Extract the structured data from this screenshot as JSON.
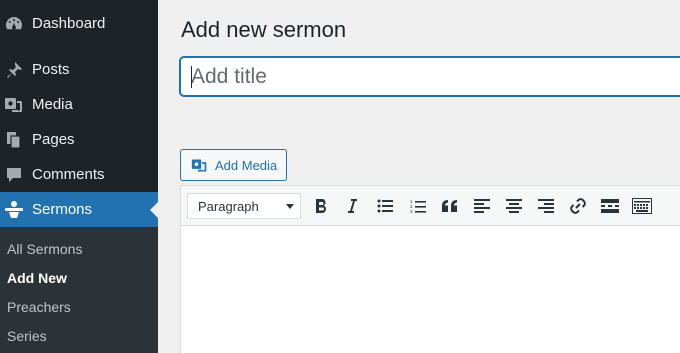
{
  "sidebar": {
    "items": [
      {
        "label": "Dashboard",
        "icon": "dashboard-icon"
      },
      {
        "label": "Posts",
        "icon": "pushpin-icon"
      },
      {
        "label": "Media",
        "icon": "media-icon"
      },
      {
        "label": "Pages",
        "icon": "pages-icon"
      },
      {
        "label": "Comments",
        "icon": "comment-icon"
      },
      {
        "label": "Sermons",
        "icon": "sermon-icon",
        "active": true
      }
    ],
    "submenu": [
      {
        "label": "All Sermons"
      },
      {
        "label": "Add New",
        "current": true
      },
      {
        "label": "Preachers"
      },
      {
        "label": "Series"
      }
    ]
  },
  "main": {
    "page_title": "Add new sermon",
    "title_input": {
      "value": "",
      "placeholder": "Add title"
    },
    "add_media_label": "Add Media",
    "toolbar": {
      "format_select": "Paragraph",
      "buttons": [
        "bold",
        "italic",
        "bulleted-list",
        "numbered-list",
        "blockquote",
        "align-left",
        "align-center",
        "align-right",
        "insert-link",
        "read-more",
        "toolbar-toggle"
      ]
    }
  },
  "colors": {
    "sidebar_bg": "#1d2327",
    "submenu_bg": "#2c3338",
    "accent": "#2271b1",
    "page_bg": "#f0f0f1"
  }
}
